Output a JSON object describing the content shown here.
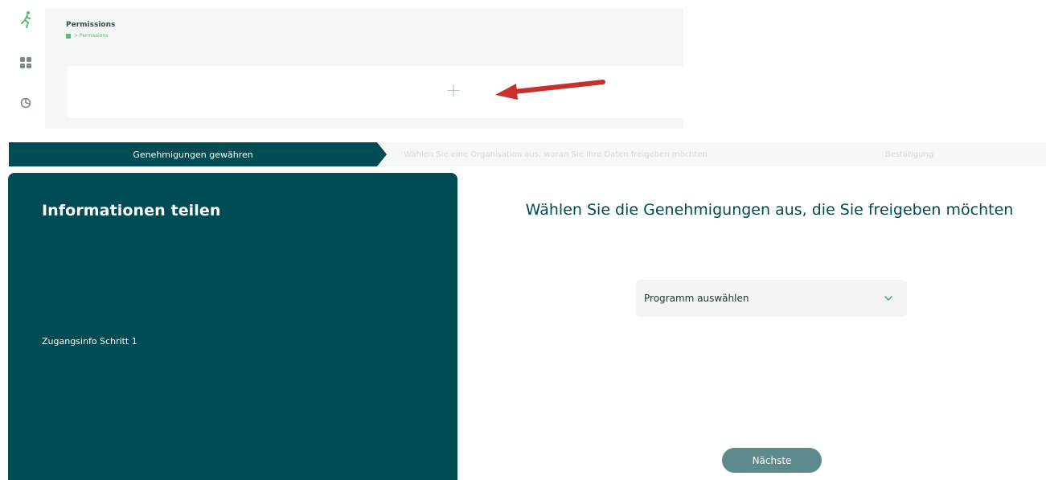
{
  "preview": {
    "title": "Permissions",
    "breadcrumb": "> Permissions",
    "add_symbol": "+"
  },
  "colors": {
    "primary": "#004c55",
    "accent_green": "#5db872",
    "arrow_red": "#c9302c",
    "button": "#5c8a8d"
  },
  "icons": {
    "logo": "running-figure-icon",
    "apps": "grid-icon",
    "chart": "pie-chart-icon",
    "home": "home-icon",
    "dropdown": "chevron-down-icon",
    "pointer": "red-arrow"
  },
  "stepper": {
    "steps": [
      {
        "label": "Genehmigungen gewähren",
        "active": true
      },
      {
        "label": "Wählen Sie eine Organisation aus, woran Sie Ihre Daten freigeben möchten",
        "active": false
      },
      {
        "label": "Bestätigung",
        "active": false
      }
    ]
  },
  "info_panel": {
    "title": "Informationen teilen",
    "step_text": "Zugangsinfo Schritt 1"
  },
  "main": {
    "heading": "Wählen Sie die Genehmigungen aus, die Sie freigeben möchten",
    "program_select": {
      "selected_label": "Programm auswählen"
    },
    "next_button": "Nächste"
  }
}
